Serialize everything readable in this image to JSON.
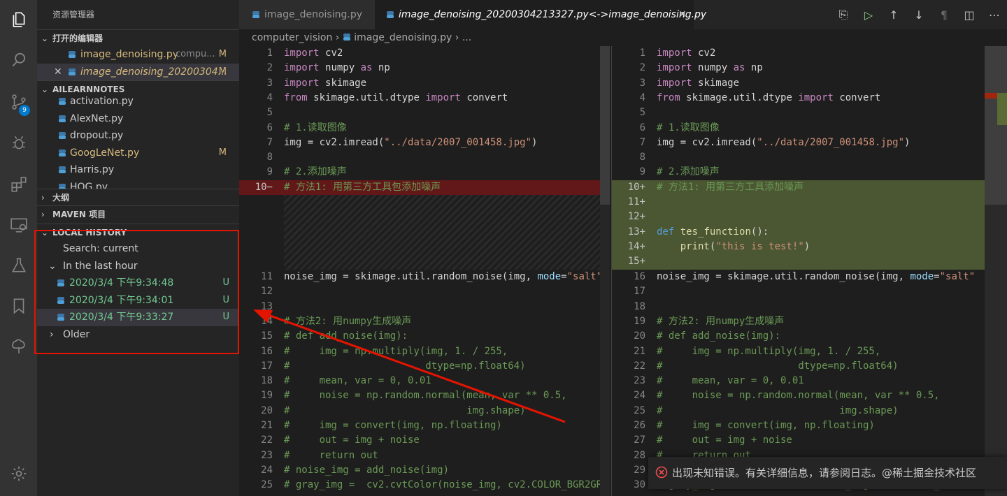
{
  "colors": {
    "accent": "#007acc",
    "highlight_box": "#e51400",
    "modified": "#d7ba7d",
    "untracked": "#73c991",
    "removed_bg": "#9b1414",
    "added_bg": "#4b5632"
  },
  "activitybar": {
    "scm_badge": "9",
    "icons": [
      "files-icon",
      "search-icon",
      "source-control-icon",
      "debug-icon",
      "extensions-icon",
      "remote-explorer-icon",
      "testing-icon",
      "bookmarks-icon",
      "tree-icon",
      "settings-gear-icon"
    ]
  },
  "sidebar": {
    "title": "资源管理器",
    "open_editors": {
      "label": "打开的编辑器",
      "items": [
        {
          "name": "image_denoising.py",
          "path": "compu...",
          "status": "M"
        },
        {
          "name": "image_denoising_20200304...",
          "status": "M"
        }
      ]
    },
    "workspace": {
      "label": "AILEARNNOTES",
      "files": [
        {
          "name": "activation.py",
          "status": ""
        },
        {
          "name": "AlexNet.py",
          "status": ""
        },
        {
          "name": "dropout.py",
          "status": ""
        },
        {
          "name": "GoogLeNet.py",
          "status": "M"
        },
        {
          "name": "Harris.py",
          "status": ""
        },
        {
          "name": "HOG.py",
          "status": ""
        }
      ]
    },
    "outline_label": "大纲",
    "maven_label": "MAVEN 项目",
    "local_history": {
      "label": "LOCAL HISTORY",
      "search": "Search: current",
      "group": "In the last hour",
      "entries": [
        {
          "time": "2020/3/4 下午9:34:48",
          "status": "U"
        },
        {
          "time": "2020/3/4 下午9:34:01",
          "status": "U"
        },
        {
          "time": "2020/3/4 下午9:33:27",
          "status": "U"
        }
      ],
      "older": "Older"
    }
  },
  "tabs": [
    {
      "label": "image_denoising.py"
    },
    {
      "label": "image_denoising_20200304213327.py<->image_denoising.py"
    }
  ],
  "breadcrumb": {
    "folder": "computer_vision",
    "file": "image_denoising.py",
    "rest": "..."
  },
  "left_editor": {
    "lines": [
      "1",
      "2",
      "3",
      "4",
      "5",
      "6",
      "7",
      "8",
      "9",
      "10−",
      "11",
      "12",
      "13",
      "14",
      "15",
      "16",
      "17",
      "18",
      "19",
      "20",
      "21",
      "22",
      "23",
      "24",
      "25"
    ]
  },
  "right_editor": {
    "lines": [
      "1",
      "2",
      "3",
      "4",
      "5",
      "6",
      "7",
      "8",
      "9",
      "10+",
      "11+",
      "12+",
      "13+",
      "14+",
      "15+",
      "16",
      "17",
      "18",
      "19",
      "20",
      "21",
      "22",
      "23",
      "24",
      "25",
      "26",
      "27",
      "28",
      "29",
      "30"
    ]
  },
  "code": {
    "import_kw": "import",
    "from_kw": "from",
    "as_kw": "as",
    "l1": "cv2",
    "l2a": "numpy",
    "l2b": "np",
    "l3": "skimage",
    "l4a": "skimage.util.dtype",
    "l4b": "convert",
    "c_read": "# 1.读取图像",
    "imread_pre": "img = cv2.imread(",
    "imread_str": "\"../data/2007_001458.jpg\"",
    "imread_post": ")",
    "c_add": "# 2.添加噪声",
    "c_m1_left": "# 方法1: 用第三方工具包添加噪声",
    "c_m1_right": "# 方法1: 用第三方工具添加噪声",
    "def_kw": "def",
    "fn_name": "tes_function",
    "fn_tail": "():",
    "print_fn": "print",
    "print_str": "\"this is test!\"",
    "noise_pre": "noise_img = skimage.util.random_noise(img, ",
    "mode_prm": "mode",
    "mode_eq": "=",
    "mode_str": "\"salt\"",
    "c_m2": "# 方法2: 用numpy生成噪声",
    "c15": "# def add_noise(img):",
    "c16": "#     img = np.multiply(img, 1. / 255,",
    "c17": "#                       dtype=np.float64)",
    "c18": "#     mean, var = 0, 0.01",
    "c19": "#     noise = np.random.normal(mean, var ** 0.5,",
    "c20": "#                              img.shape)",
    "c21": "#     img = convert(img, np.floating)",
    "c22": "#     out = img + noise",
    "c23": "#     return out",
    "c24": "# noise_img = add_noise(img)",
    "c25": "# gray_img =  cv2.cvtColor(noise_img, cv2.COLOR_BGR2GR",
    "c30": "# gray_img =  cv2.cvtColor(noise_img, cv2.COLOR_BGR2GR"
  },
  "notification": {
    "message": "出现未知错误。有关详细信息，请参阅日志。@稀土掘金技术社区"
  }
}
